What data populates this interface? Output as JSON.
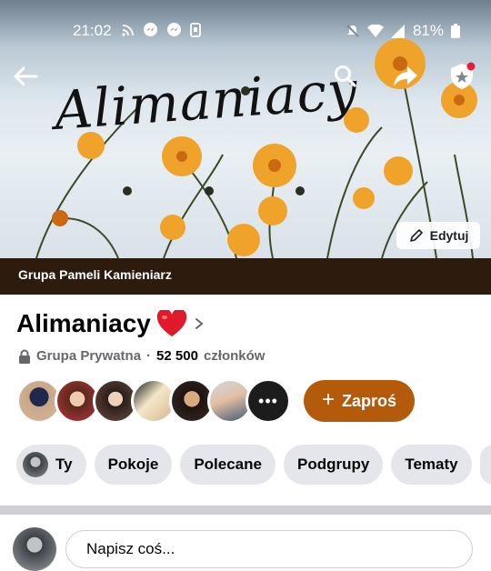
{
  "status_bar": {
    "time": "21:02",
    "battery_percent": "81%",
    "left_icons": [
      "cast-icon",
      "messenger-icon",
      "messenger-icon",
      "screenshot-icon"
    ],
    "right_icons": [
      "mute-icon",
      "wifi-icon",
      "signal-icon",
      "battery-icon"
    ]
  },
  "header": {
    "cover_script_text": "Alimaniacy",
    "edit_label": "Edytuj",
    "owner_label": "Grupa Pameli Kamieniarz"
  },
  "group": {
    "name": "Alimaniacy",
    "emoji": "❤️",
    "privacy": "Grupa Prywatna",
    "separator": "·",
    "member_count": "52 500",
    "member_suffix": "członków"
  },
  "members": {
    "more_label": "•••"
  },
  "invite": {
    "plus": "+",
    "label": "Zaproś"
  },
  "tabs": [
    {
      "label": "Ty"
    },
    {
      "label": "Pokoje"
    },
    {
      "label": "Polecane"
    },
    {
      "label": "Podgrupy"
    },
    {
      "label": "Tematy"
    }
  ],
  "composer": {
    "placeholder": "Napisz coś..."
  },
  "colors": {
    "owner_strip": "#2d1c0e",
    "invite_button": "#b45a0b",
    "tab_bg": "#e4e6eb",
    "notification_dot": "#e41e3f"
  }
}
